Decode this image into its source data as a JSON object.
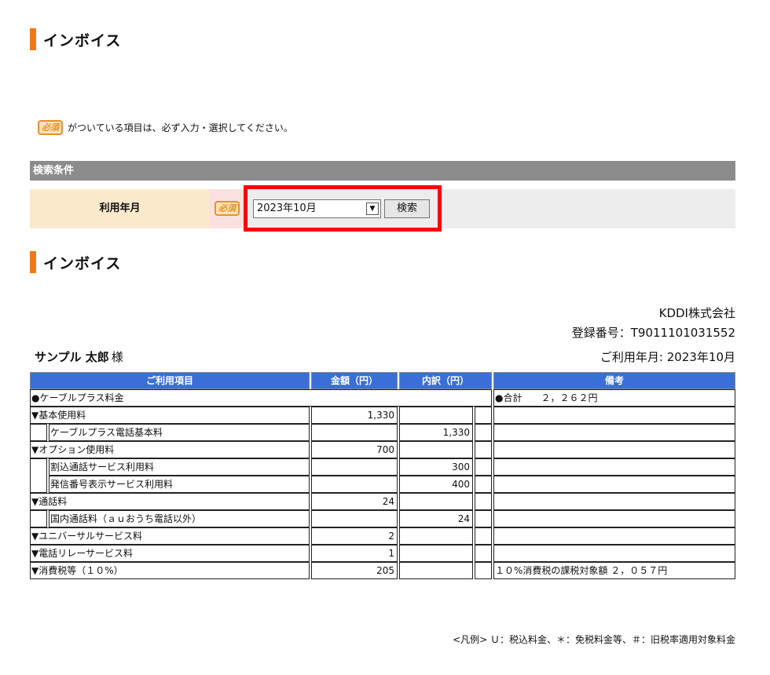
{
  "page": {
    "title": "インボイス",
    "section2_title": "インボイス"
  },
  "notice": {
    "badge": "必須",
    "text": "がついている項目は、必ず入力・選択してください。"
  },
  "search": {
    "header": "検索条件",
    "label": "利用年月",
    "required_badge": "必須",
    "selected_month": "2023年10月",
    "dropdown_icon": "chevron-down-icon",
    "button_label": "検索"
  },
  "invoice": {
    "company": "KDDI株式会社",
    "registration_no": "登録番号：T9011101031552",
    "customer_name": "サンプル 太郎",
    "honorific": "様",
    "usage_month": "ご利用年月: 2023年10月",
    "columns": [
      "ご利用項目",
      "金額（円）",
      "内訳（円）",
      "備考"
    ],
    "rows": [
      {
        "item": "●ケーブルプラス料金",
        "amount": "",
        "detail": "",
        "remark": "●合計　　２，２６２円"
      },
      {
        "item": "▼基本使用料",
        "amount": "1,330",
        "detail": "",
        "remark": ""
      },
      {
        "item": "ケーブルプラス電話基本料",
        "amount": "",
        "detail": "1,330",
        "remark": ""
      },
      {
        "item": "▼オプション使用料",
        "amount": "700",
        "detail": "",
        "remark": ""
      },
      {
        "item": "割込通話サービス利用料",
        "amount": "",
        "detail": "300",
        "remark": ""
      },
      {
        "item": "発信番号表示サービス利用料",
        "amount": "",
        "detail": "400",
        "remark": ""
      },
      {
        "item": "▼通話料",
        "amount": "24",
        "detail": "",
        "remark": ""
      },
      {
        "item": "国内通話料（ａｕおうち電話以外）",
        "amount": "",
        "detail": "24",
        "remark": ""
      },
      {
        "item": "▼ユニバーサルサービス料",
        "amount": "2",
        "detail": "",
        "remark": ""
      },
      {
        "item": "▼電話リレーサービス料",
        "amount": "1",
        "detail": "",
        "remark": ""
      },
      {
        "item": "▼消費税等（１０%）",
        "amount": "205",
        "detail": "",
        "remark": "１０%消費税の課税対象額 ２，０５７円"
      }
    ],
    "legend": "<凡例> Ｕ：税込料金、＊：免税料金等、＃：旧税率適用対象料金"
  },
  "colors": {
    "accent": "#f07a18",
    "header_blue": "#3a6fd8",
    "highlight_red": "#ff0000"
  }
}
